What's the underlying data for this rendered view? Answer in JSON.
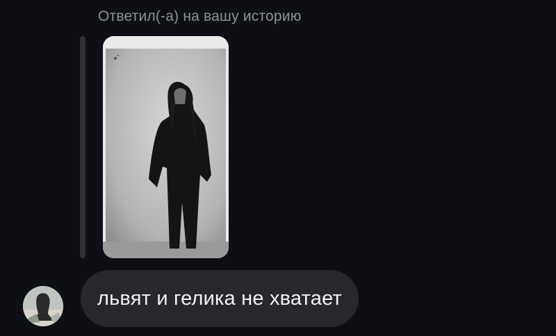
{
  "reply": {
    "caption": "Ответил(-а) на вашу историю"
  },
  "story": {
    "icon": "story-image"
  },
  "message": {
    "text": "львят и гелика не хватает"
  },
  "sender": {
    "avatar_icon": "user-avatar"
  },
  "colors": {
    "background": "#0d0f14",
    "bubble": "#26282d",
    "caption": "#8e9097",
    "reply_bar": "#2e3036"
  }
}
